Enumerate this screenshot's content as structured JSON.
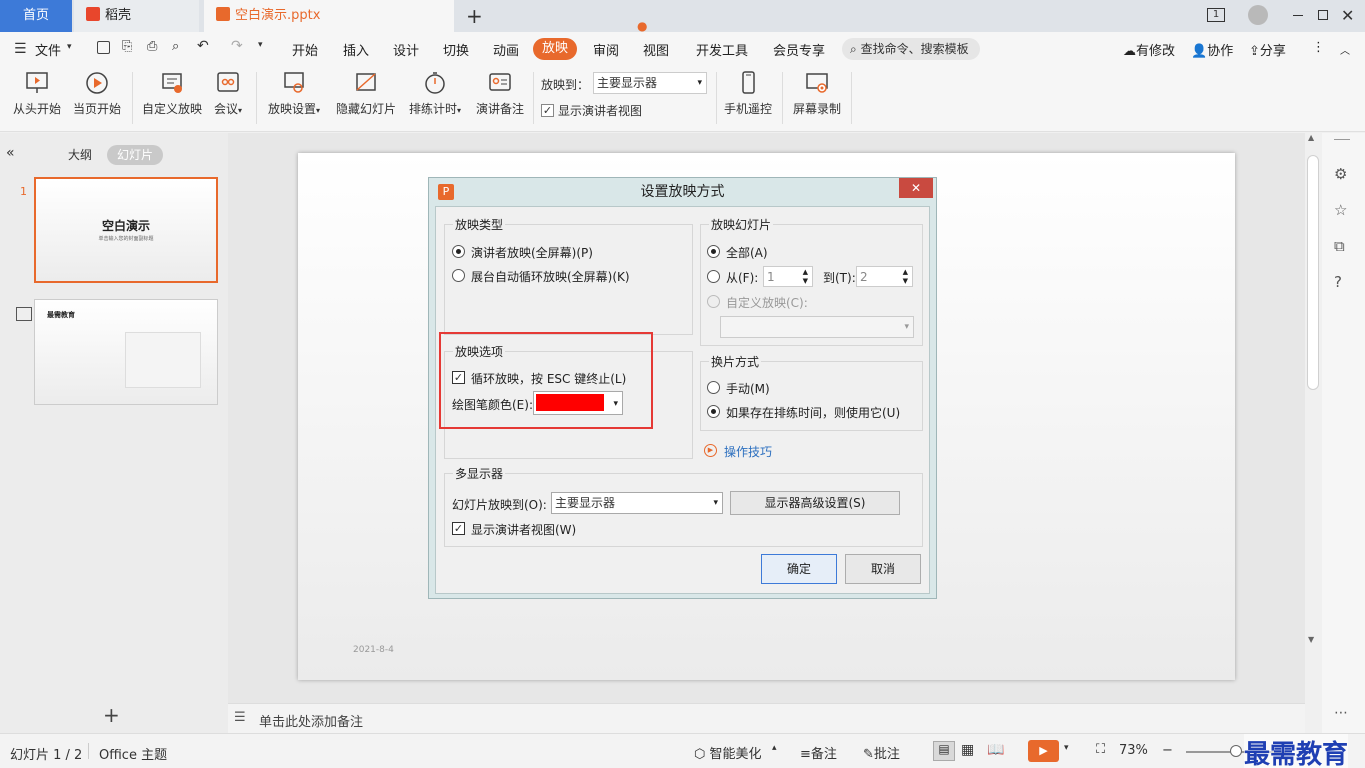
{
  "tabs": {
    "home": "首页",
    "docer": "稻壳",
    "file": "空白演示.pptx"
  },
  "menu": {
    "file": "文件",
    "items": [
      "开始",
      "插入",
      "设计",
      "切换",
      "动画",
      "放映",
      "审阅",
      "视图",
      "开发工具",
      "会员专享"
    ],
    "active": "放映",
    "search": "查找命令、搜索模板",
    "right": [
      "有修改",
      "协作",
      "分享"
    ]
  },
  "ribbon": {
    "from_start": "从头开始",
    "from_current": "当页开始",
    "custom": "自定义放映",
    "meeting": "会议",
    "settings": "放映设置",
    "hide": "隐藏幻灯片",
    "rehearse": "排练计时",
    "notes": "演讲备注",
    "show_to_label": "放映到：",
    "show_to_value": "主要显示器",
    "presenter_view": "显示演讲者视图",
    "phone_remote": "手机遥控",
    "screen_record": "屏幕录制"
  },
  "leftpanel": {
    "outline": "大纲",
    "slides": "幻灯片",
    "slide1_num": "1",
    "slide1_title": "空白演示",
    "slide1_sub": "单击输入您的封面副标题",
    "slide2_title": "最需教育",
    "add": "+"
  },
  "slide": {
    "date": "2021-8-4"
  },
  "notes": {
    "placeholder": "单击此处添加备注"
  },
  "status": {
    "slide_count": "幻灯片 1 / 2",
    "theme": "Office 主题",
    "beautify": "智能美化",
    "notes": "备注",
    "comments": "批注",
    "zoom": "73%",
    "watermark": "最需教育"
  },
  "dialog": {
    "title": "设置放映方式",
    "type_group": "放映类型",
    "type_presenter": "演讲者放映(全屏幕)(P)",
    "type_kiosk": "展台自动循环放映(全屏幕)(K)",
    "slides_group": "放映幻灯片",
    "slides_all": "全部(A)",
    "slides_from": "从(F):",
    "slides_from_val": "1",
    "slides_to": "到(T):",
    "slides_to_val": "2",
    "slides_custom": "自定义放映(C):",
    "options_group": "放映选项",
    "loop": "循环放映，按 ESC 键终止(L)",
    "pen_color": "绘图笔颜色(E):",
    "pen_color_value": "#ff0000",
    "advance_group": "换片方式",
    "advance_manual": "手动(M)",
    "advance_timing": "如果存在排练时间，则使用它(U)",
    "tips": "操作技巧",
    "multi_group": "多显示器",
    "show_on": "幻灯片放映到(O):",
    "show_on_value": "主要显示器",
    "advanced": "显示器高级设置(S)",
    "presenter": "显示演讲者视图(W)",
    "ok": "确定",
    "cancel": "取消"
  },
  "colors": {
    "accent": "#e8692c",
    "highlight": "#e53935",
    "tab_home": "#3d7ad8"
  }
}
